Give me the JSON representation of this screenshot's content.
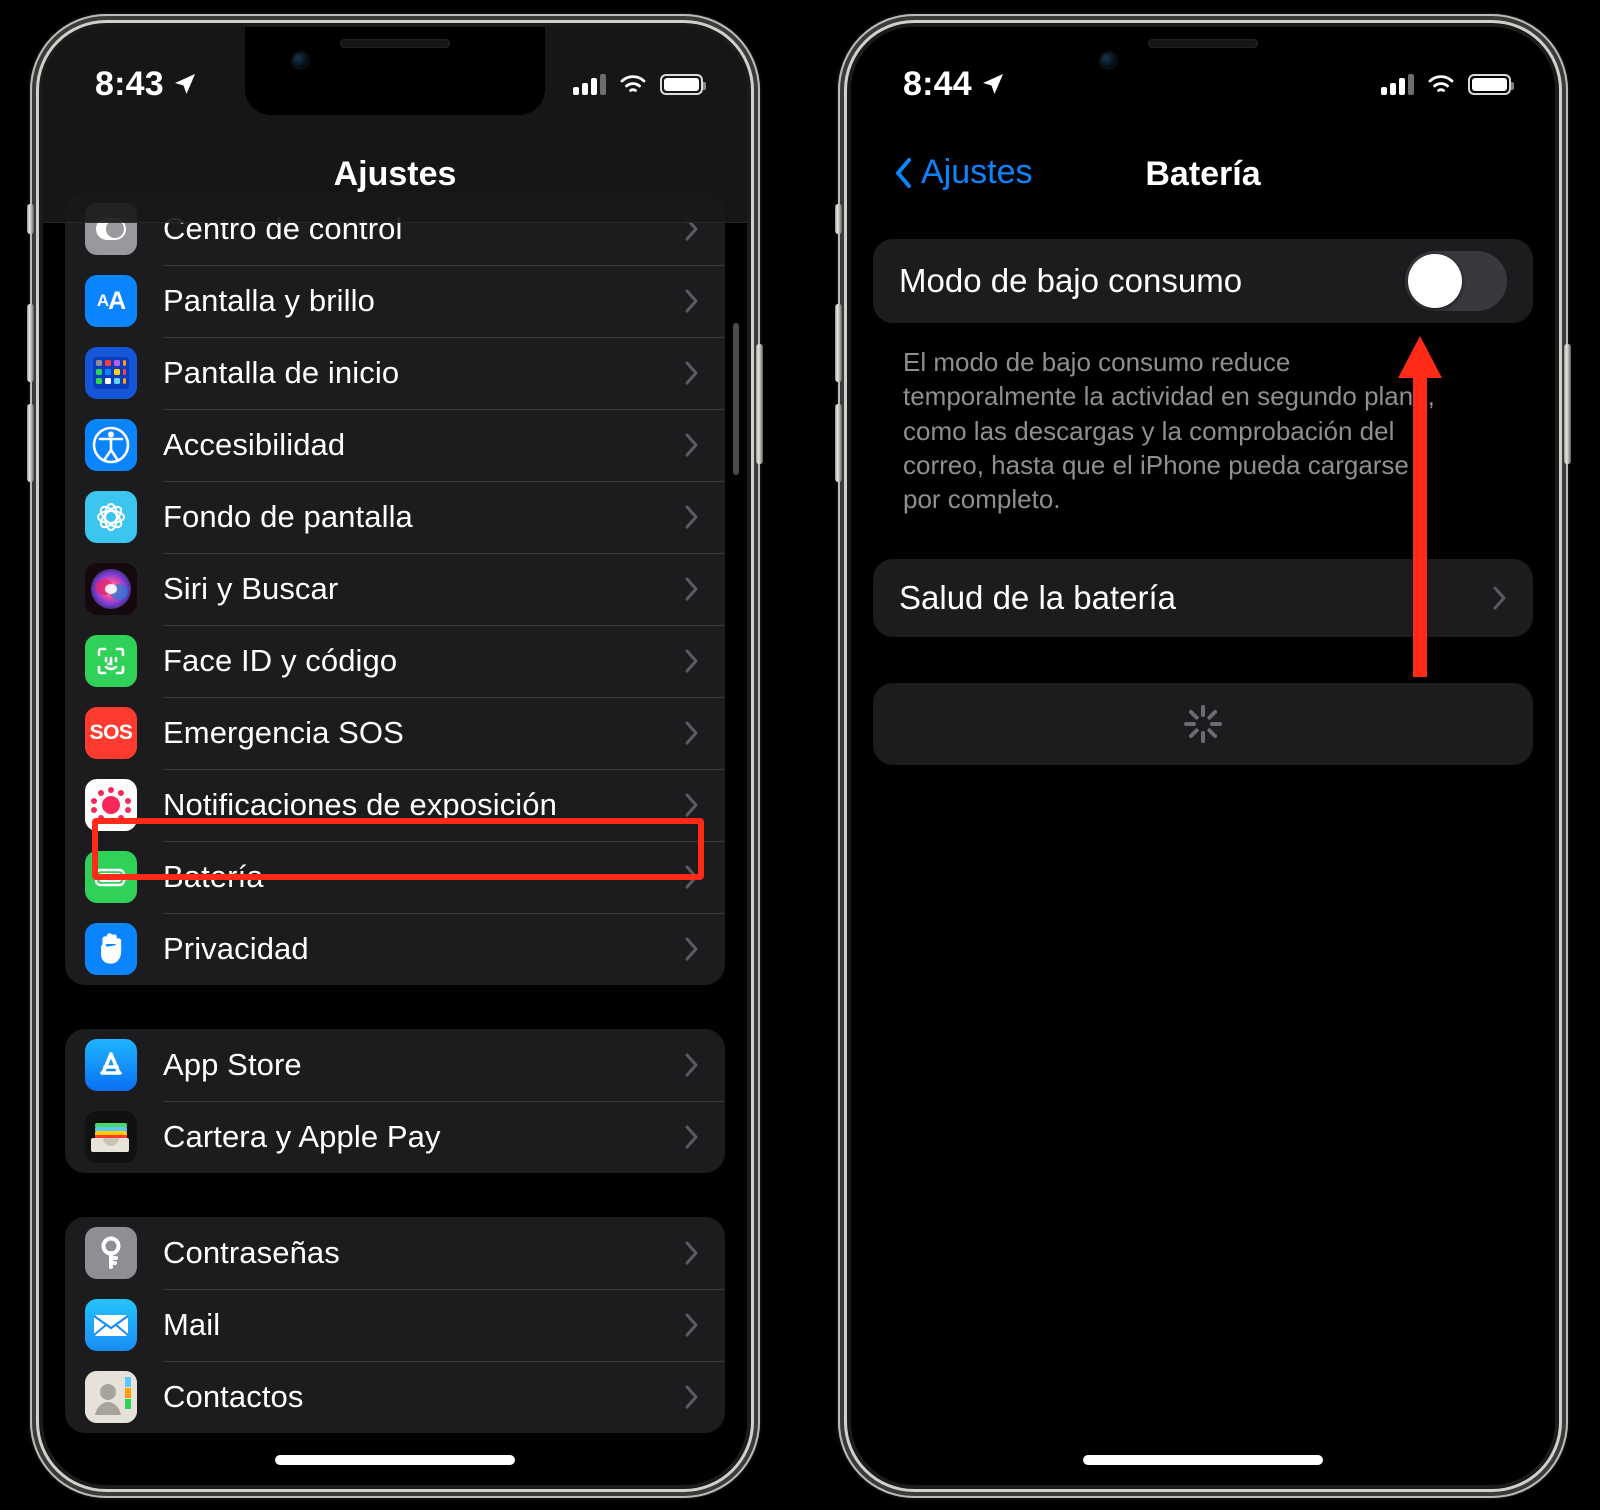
{
  "left_phone": {
    "status_bar": {
      "time": "8:43",
      "location_icon": "location-arrow-icon",
      "signal_icon": "cellular-signal-icon",
      "wifi_icon": "wifi-icon",
      "battery_icon": "battery-full-icon"
    },
    "nav": {
      "title": "Ajustes"
    },
    "groups": [
      {
        "items": [
          {
            "label": "Centro de control",
            "icon": "control-center-icon",
            "clipped": true
          },
          {
            "label": "Pantalla y brillo",
            "icon": "display-brightness-icon"
          },
          {
            "label": "Pantalla de inicio",
            "icon": "home-screen-icon"
          },
          {
            "label": "Accesibilidad",
            "icon": "accessibility-icon"
          },
          {
            "label": "Fondo de pantalla",
            "icon": "wallpaper-icon"
          },
          {
            "label": "Siri y Buscar",
            "icon": "siri-icon"
          },
          {
            "label": "Face ID y código",
            "icon": "face-id-icon"
          },
          {
            "label": "Emergencia SOS",
            "icon": "emergency-sos-icon"
          },
          {
            "label": "Notificaciones de exposición",
            "icon": "exposure-notifications-icon"
          },
          {
            "label": "Batería",
            "icon": "battery-settings-icon",
            "highlighted": true
          },
          {
            "label": "Privacidad",
            "icon": "privacy-hand-icon"
          }
        ]
      },
      {
        "items": [
          {
            "label": "App Store",
            "icon": "app-store-icon"
          },
          {
            "label": "Cartera y Apple Pay",
            "icon": "wallet-icon"
          }
        ]
      },
      {
        "items": [
          {
            "label": "Contraseñas",
            "icon": "passwords-key-icon"
          },
          {
            "label": "Mail",
            "icon": "mail-icon"
          },
          {
            "label": "Contactos",
            "icon": "contacts-icon"
          }
        ]
      }
    ]
  },
  "right_phone": {
    "status_bar": {
      "time": "8:44",
      "location_icon": "location-arrow-icon",
      "signal_icon": "cellular-signal-icon",
      "wifi_icon": "wifi-icon",
      "battery_icon": "battery-full-icon"
    },
    "nav": {
      "back_label": "Ajustes",
      "title": "Batería"
    },
    "low_power": {
      "label": "Modo de bajo consumo",
      "state": "off",
      "description": "El modo de bajo consumo reduce temporalmente la actividad en segundo plano, como las descargas y la comprobación del correo, hasta que el iPhone pueda cargarse por completo."
    },
    "battery_health": {
      "label": "Salud de la batería"
    },
    "loading_card": {
      "icon": "activity-spinner-icon"
    }
  },
  "annotation": {
    "highlight_color": "#ff2a17",
    "arrow_color": "#ff2a17",
    "target": "Batería row / Modo de bajo consumo toggle"
  }
}
